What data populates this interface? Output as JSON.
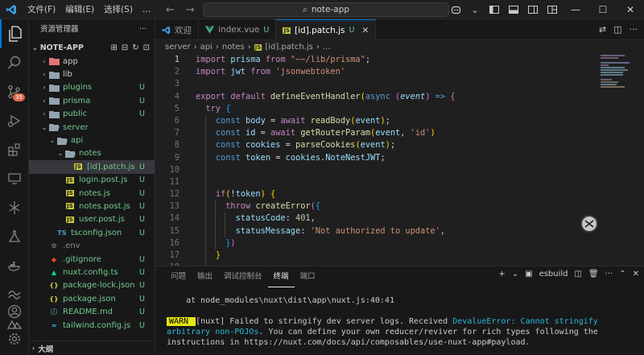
{
  "titlebar": {
    "menu": [
      "文件(F)",
      "编辑(E)",
      "选择(S)",
      "…"
    ],
    "search": "note-app"
  },
  "activity": {
    "source_control_badge": "35"
  },
  "sidebar": {
    "title": "资源管理器",
    "root": "NOTE-APP",
    "tree": [
      {
        "label": "app",
        "git": "",
        "depth": 1,
        "chev": "›",
        "icon": "folder-red",
        "color": "normal"
      },
      {
        "label": "lib",
        "git": "",
        "depth": 1,
        "chev": "›",
        "icon": "folder",
        "color": "normal"
      },
      {
        "label": "plugins",
        "git": "U",
        "depth": 1,
        "chev": "›",
        "icon": "folder",
        "color": "green"
      },
      {
        "label": "prisma",
        "git": "U",
        "depth": 1,
        "chev": "›",
        "icon": "folder",
        "color": "green"
      },
      {
        "label": "public",
        "git": "U",
        "depth": 1,
        "chev": "›",
        "icon": "folder",
        "color": "green"
      },
      {
        "label": "server",
        "git": "",
        "depth": 1,
        "chev": "⌄",
        "icon": "folder-open",
        "color": "green"
      },
      {
        "label": "api",
        "git": "",
        "depth": 2,
        "chev": "⌄",
        "icon": "folder-open",
        "color": "green"
      },
      {
        "label": "notes",
        "git": "",
        "depth": 3,
        "chev": "⌄",
        "icon": "folder-open",
        "color": "green"
      },
      {
        "label": "[id].patch.js",
        "git": "U",
        "depth": 4,
        "chev": "",
        "icon": "js",
        "color": "green",
        "selected": true
      },
      {
        "label": "login.post.js",
        "git": "U",
        "depth": 3,
        "chev": "",
        "icon": "js",
        "color": "green"
      },
      {
        "label": "notes.js",
        "git": "U",
        "depth": 3,
        "chev": "",
        "icon": "js",
        "color": "green"
      },
      {
        "label": "notes.post.js",
        "git": "U",
        "depth": 3,
        "chev": "",
        "icon": "js",
        "color": "green"
      },
      {
        "label": "user.post.js",
        "git": "U",
        "depth": 3,
        "chev": "",
        "icon": "js",
        "color": "green"
      },
      {
        "label": "tsconfig.json",
        "git": "U",
        "depth": 2,
        "chev": "",
        "icon": "ts",
        "color": "green"
      },
      {
        "label": ".env",
        "git": "",
        "depth": 1,
        "chev": "",
        "icon": "env",
        "color": "dim"
      },
      {
        "label": ".gitignore",
        "git": "U",
        "depth": 1,
        "chev": "",
        "icon": "git",
        "color": "green"
      },
      {
        "label": "nuxt.config.ts",
        "git": "U",
        "depth": 1,
        "chev": "",
        "icon": "nuxt",
        "color": "green"
      },
      {
        "label": "package-lock.json",
        "git": "U",
        "depth": 1,
        "chev": "",
        "icon": "json",
        "color": "green"
      },
      {
        "label": "package.json",
        "git": "U",
        "depth": 1,
        "chev": "",
        "icon": "json",
        "color": "green"
      },
      {
        "label": "README.md",
        "git": "U",
        "depth": 1,
        "chev": "",
        "icon": "info",
        "color": "green"
      },
      {
        "label": "tailwind.config.js",
        "git": "U",
        "depth": 1,
        "chev": "",
        "icon": "tailwind",
        "color": "green"
      }
    ],
    "outline": "大纲"
  },
  "tabs": [
    {
      "label": "欢迎",
      "status": "",
      "icon": "vscode"
    },
    {
      "label": "index.vue",
      "status": "U",
      "icon": "vue"
    },
    {
      "label": "[id].patch.js",
      "status": "U",
      "icon": "js",
      "active": true
    }
  ],
  "breadcrumb": [
    "server",
    "api",
    "notes",
    "[id].patch.js",
    "..."
  ],
  "editor": {
    "current_line": 1
  },
  "panel": {
    "tabs": [
      "问题",
      "输出",
      "调试控制台",
      "终端",
      "端口"
    ],
    "active_tab": "终端",
    "terminal_name": "esbuild",
    "lines": {
      "stack": "    at node_modules\\nuxt\\dist\\app\\nuxt.js:40:41",
      "warn_badge": " WARN ",
      "warn_text": " [nuxt] Failed to stringify dev server logs. Received ",
      "warn_error": "DevalueError: Cannot stringify arbitrary non-POJOs",
      "warn_rest": ". You can define your own reducer/reviver for rich types following the instructions in https://nuxt.com/docs/api/composables/use-nuxt-app#payload."
    }
  }
}
